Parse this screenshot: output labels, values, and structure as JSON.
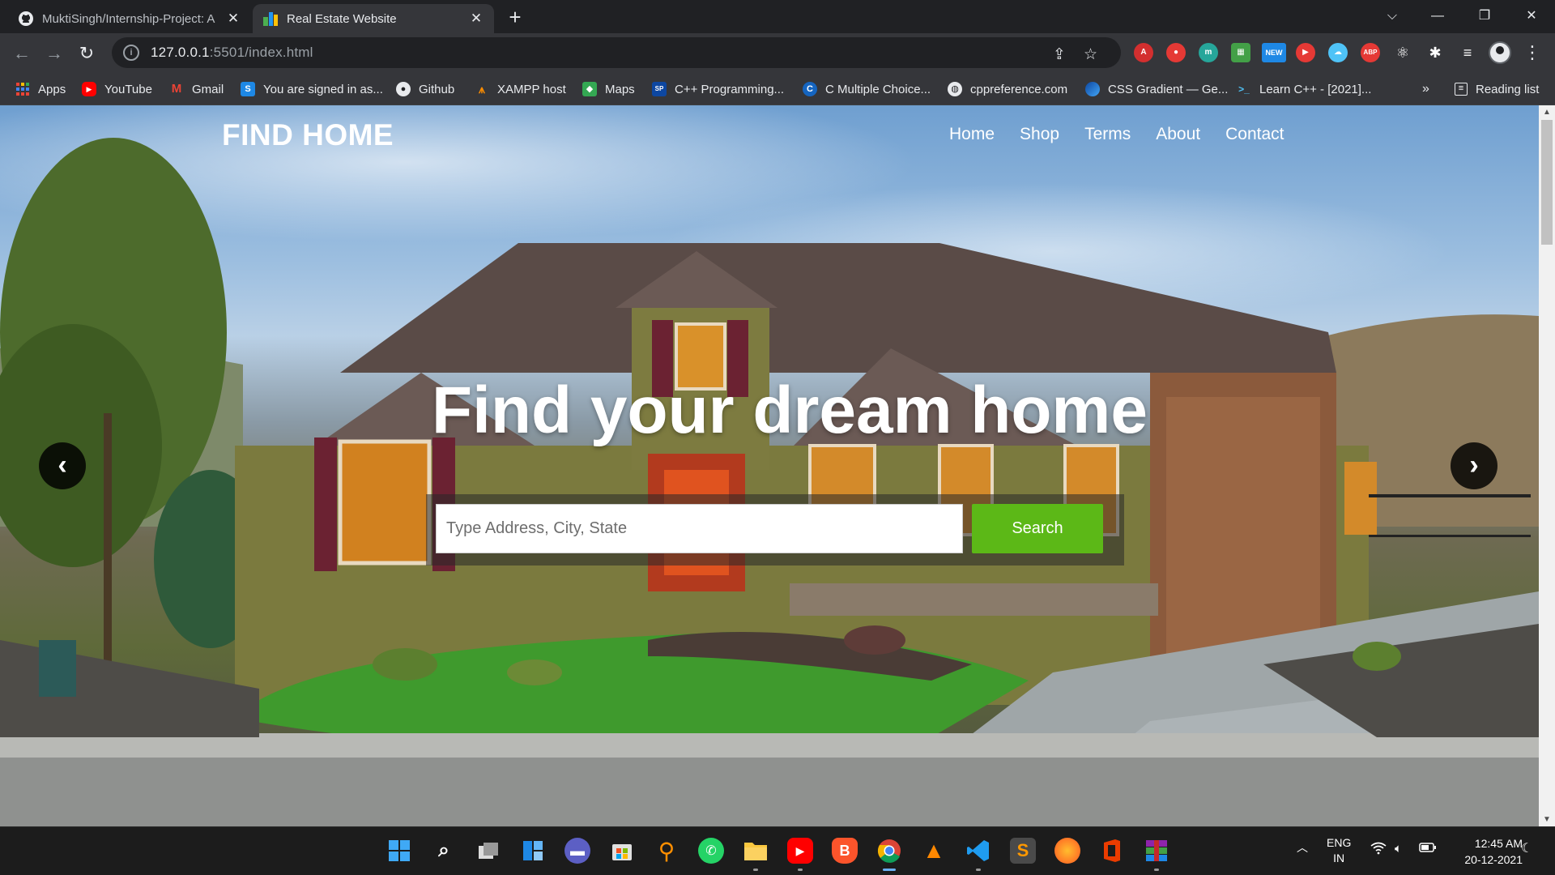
{
  "browser": {
    "tabs": [
      {
        "title": "MuktiSingh/Internship-Project: A",
        "icon": "github-icon",
        "active": false
      },
      {
        "title": "Real Estate Website",
        "icon": "site-favicon",
        "active": true
      }
    ],
    "url_host": "127.0.0.1",
    "url_rest": ":5501/index.html",
    "bookmarks": [
      {
        "label": "Apps",
        "icon": "apps-grid-icon"
      },
      {
        "label": "YouTube",
        "icon": "youtube-icon"
      },
      {
        "label": "Gmail",
        "icon": "gmail-icon"
      },
      {
        "label": "You are signed in as...",
        "icon": "s-logo-icon"
      },
      {
        "label": "Github",
        "icon": "github-icon"
      },
      {
        "label": "XAMPP host",
        "icon": "xampp-icon"
      },
      {
        "label": "Maps",
        "icon": "maps-icon"
      },
      {
        "label": "C++ Programming...",
        "icon": "cpp-icon"
      },
      {
        "label": "C Multiple Choice...",
        "icon": "c-icon"
      },
      {
        "label": "cppreference.com",
        "icon": "globe-icon"
      },
      {
        "label": "CSS Gradient — Ge...",
        "icon": "gradient-icon"
      },
      {
        "label": "Learn C++ - [2021]...",
        "icon": "terminal-icon"
      }
    ],
    "bookmarks_overflow": "»",
    "reading_list": "Reading list",
    "ext_badge": "NEW",
    "abp_label": "ABP",
    "colors": {
      "tabstrip": "#202124",
      "toolbar": "#35363a"
    }
  },
  "site": {
    "logo": "FIND HOME",
    "nav": [
      "Home",
      "Shop",
      "Terms",
      "About",
      "Contact"
    ],
    "hero_title": "Find your dream home",
    "search_placeholder": "Type Address, City, State",
    "search_button": "Search",
    "accent": "#5cb817"
  },
  "taskbar": {
    "apps": [
      "windows-start-icon",
      "search-icon",
      "task-view-icon",
      "widgets-icon",
      "teams-chat-icon",
      "store-icon",
      "search-app-icon",
      "whatsapp-icon",
      "file-explorer-icon",
      "youtube-icon",
      "brave-icon",
      "chrome-icon",
      "vlc-icon",
      "vscode-icon",
      "sublime-icon",
      "firefox-icon",
      "office-icon",
      "winrar-icon"
    ],
    "lang_1": "ENG",
    "lang_2": "IN",
    "time": "12:45 AM",
    "date": "20-12-2021"
  }
}
